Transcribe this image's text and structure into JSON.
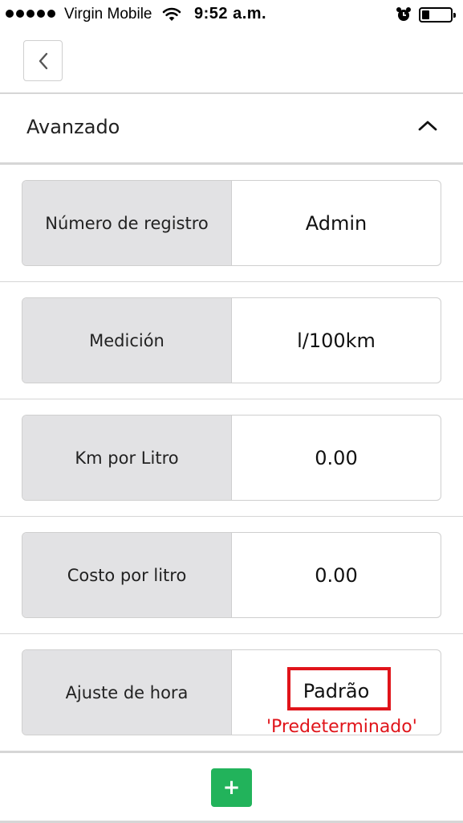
{
  "status_bar": {
    "carrier": "Virgin Mobile",
    "time": "9:52 a.m."
  },
  "section": {
    "title": "Avanzado"
  },
  "fields": [
    {
      "label": "Número de registro",
      "value": "Admin"
    },
    {
      "label": "Medición",
      "value": "l/100km"
    },
    {
      "label": "Km por Litro",
      "value": "0.00"
    },
    {
      "label": "Costo por litro",
      "value": "0.00"
    },
    {
      "label": "Ajuste de hora",
      "value": "Padrão"
    }
  ],
  "annotation": "'Predeterminado'",
  "add_button": {
    "label": "+"
  },
  "icons": {
    "back": "chevron-left-icon",
    "collapse": "chevron-up-icon",
    "wifi": "wifi-icon",
    "alarm": "alarm-icon",
    "battery": "battery-icon"
  },
  "colors": {
    "add_button": "#22b35b",
    "label_background": "#e2e2e4",
    "annotation": "#e0141a"
  }
}
